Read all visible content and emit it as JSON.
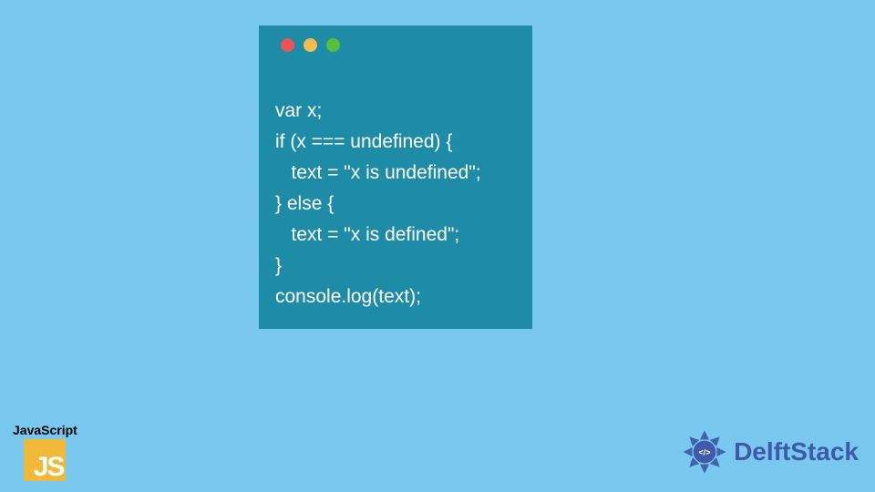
{
  "code_window": {
    "traffic_light_colors": {
      "red": "#ec5353",
      "yellow": "#f3bd4e",
      "green": "#57c038"
    },
    "lines": [
      "var x;",
      "if (x === undefined) {",
      "   text = \"x is undefined\";",
      "} else {",
      "   text = \"x is defined\";",
      "}",
      "console.log(text);"
    ]
  },
  "js_badge": {
    "label": "JavaScript",
    "logo_text": "JS",
    "logo_bg": "#f0b93a"
  },
  "brand": {
    "name": "DelftStack",
    "code_glyph": "</>",
    "accent": "#3e5aa8"
  }
}
